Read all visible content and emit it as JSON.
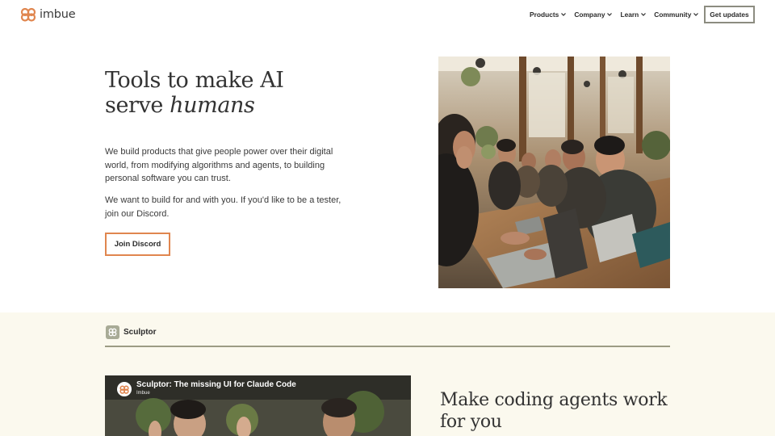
{
  "header": {
    "brand": "imbue",
    "nav": [
      {
        "label": "Products"
      },
      {
        "label": "Company"
      },
      {
        "label": "Learn"
      },
      {
        "label": "Community"
      }
    ],
    "cta_label": "Get updates"
  },
  "hero": {
    "title_line1": "Tools to make AI",
    "title_line2_plain": "serve ",
    "title_line2_italic": "humans",
    "paragraph1": "We build products that give people power over their digital world, from modifying algorithms and agents, to building personal software you can trust.",
    "paragraph2": "We want to build for and with you. If you'd like to be a tester, join our Discord.",
    "button_label": "Join Discord"
  },
  "sculptor": {
    "tag_label": "Sculptor",
    "video": {
      "title": "Sculptor: The missing UI for Claude Code",
      "channel": "Imbue"
    },
    "heading": "Make coding agents work for you"
  },
  "colors": {
    "brand_orange": "#e0864f",
    "section_bg": "#fbf9ee",
    "divider": "#9c9c84"
  }
}
